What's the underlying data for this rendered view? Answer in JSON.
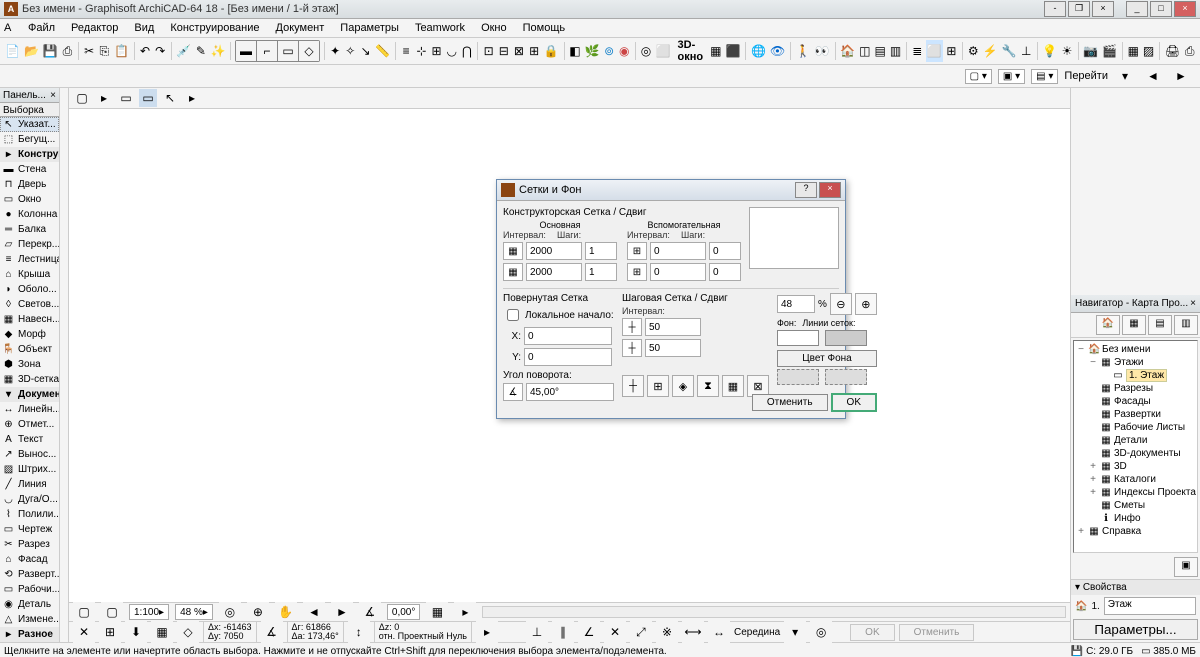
{
  "title": "Без имени - Graphisoft ArchiCAD-64 18 - [Без имени / 1-й этаж]",
  "menu": [
    "Файл",
    "Редактор",
    "Вид",
    "Конструирование",
    "Документ",
    "Параметры",
    "Teamwork",
    "Окно",
    "Помощь"
  ],
  "nav_go": "Перейти",
  "txt3d": "3D-окно",
  "palette": {
    "title": "Панель...",
    "sub": "Выборка"
  },
  "tools": [
    {
      "l": "Указат...",
      "sel": true,
      "ico": "↖"
    },
    {
      "l": "Бегущ...",
      "ico": "⬚"
    },
    {
      "l": "Конструирс",
      "hdr": true,
      "ico": "▸"
    },
    {
      "l": "Стена",
      "ico": "▬"
    },
    {
      "l": "Дверь",
      "ico": "⊓"
    },
    {
      "l": "Окно",
      "ico": "▭"
    },
    {
      "l": "Колонна",
      "ico": "●"
    },
    {
      "l": "Балка",
      "ico": "═"
    },
    {
      "l": "Перекр...",
      "ico": "▱"
    },
    {
      "l": "Лестница",
      "ico": "≡"
    },
    {
      "l": "Крыша",
      "ico": "⌂"
    },
    {
      "l": "Оболо...",
      "ico": "◗"
    },
    {
      "l": "Светов...",
      "ico": "◊"
    },
    {
      "l": "Навесн...",
      "ico": "▦"
    },
    {
      "l": "Морф",
      "ico": "◆"
    },
    {
      "l": "Объект",
      "ico": "🪑"
    },
    {
      "l": "Зона",
      "ico": "⬢"
    },
    {
      "l": "3D-сетка",
      "ico": "▦"
    },
    {
      "l": "Документир",
      "hdr": true,
      "ico": "▾"
    },
    {
      "l": "Линейн...",
      "ico": "↔"
    },
    {
      "l": "Отмет...",
      "ico": "⊕"
    },
    {
      "l": "Текст",
      "ico": "A"
    },
    {
      "l": "Вынос...",
      "ico": "↗"
    },
    {
      "l": "Штрих...",
      "ico": "▨"
    },
    {
      "l": "Линия",
      "ico": "╱"
    },
    {
      "l": "Дуга/О...",
      "ico": "◡"
    },
    {
      "l": "Полили...",
      "ico": "⌇"
    },
    {
      "l": "Чертеж",
      "ico": "▭"
    },
    {
      "l": "Разрез",
      "ico": "✂"
    },
    {
      "l": "Фасад",
      "ico": "⌂"
    },
    {
      "l": "Разверт...",
      "ico": "⟲"
    },
    {
      "l": "Рабочи...",
      "ico": "▭"
    },
    {
      "l": "Деталь",
      "ico": "◉"
    },
    {
      "l": "Измене...",
      "ico": "△"
    },
    {
      "l": "Разное",
      "hdr": true,
      "ico": "▸"
    }
  ],
  "navigator": {
    "title": "Навигатор - Карта Про...",
    "tree": [
      {
        "l": "Без имени",
        "ico": "🏠",
        "exp": "−",
        "ind": 0
      },
      {
        "l": "Этажи",
        "ico": "▦",
        "exp": "−",
        "ind": 1
      },
      {
        "l": "1. Этаж",
        "ico": "▭",
        "ind": 2,
        "sel": true
      },
      {
        "l": "Разрезы",
        "ico": "▦",
        "ind": 1
      },
      {
        "l": "Фасады",
        "ico": "▦",
        "ind": 1
      },
      {
        "l": "Развертки",
        "ico": "▦",
        "ind": 1
      },
      {
        "l": "Рабочие Листы",
        "ico": "▦",
        "ind": 1
      },
      {
        "l": "Детали",
        "ico": "▦",
        "ind": 1
      },
      {
        "l": "3D-документы",
        "ico": "▦",
        "ind": 1
      },
      {
        "l": "3D",
        "ico": "▦",
        "exp": "+",
        "ind": 1
      },
      {
        "l": "Каталоги",
        "ico": "▦",
        "exp": "+",
        "ind": 1
      },
      {
        "l": "Индексы Проекта",
        "ico": "▦",
        "exp": "+",
        "ind": 1
      },
      {
        "l": "Сметы",
        "ico": "▦",
        "ind": 1
      },
      {
        "l": "Инфо",
        "ico": "ℹ",
        "ind": 1
      },
      {
        "l": "Справка",
        "ico": "▦",
        "exp": "+",
        "ind": 0
      }
    ],
    "props": {
      "title": "Свойства",
      "n": "1.",
      "name": "Этаж",
      "btn": "Параметры..."
    }
  },
  "dialog": {
    "title": "Сетки и Фон",
    "s1": "Конструкторская Сетка / Сдвиг",
    "main": "Основная",
    "aux": "Вспомогательная",
    "interval": "Интервал:",
    "steps": "Шаги:",
    "v1": "2000",
    "v2": "1",
    "v3": "2000",
    "v4": "1",
    "v5": "0",
    "v6": "0",
    "v7": "0",
    "v8": "0",
    "s2": "Повернутая Сетка",
    "local": "Локальное начало:",
    "x": "X:",
    "y": "Y:",
    "xv": "0",
    "yv": "0",
    "angle": "Угол поворота:",
    "anglev": "45,00°",
    "s3": "Шаговая Сетка / Сдвиг",
    "sv1": "50",
    "sv2": "50",
    "pct": "48",
    "pctl": "%",
    "bg": "Фон:",
    "lines": "Линии сеток:",
    "bgbtn": "Цвет Фона",
    "cancel": "Отменить",
    "ok": "OK"
  },
  "coords": {
    "dx": "Δx: -61463",
    "dy": "Δy: 7050",
    "dr": "Δг: 61866",
    "da": "Δа: 173,46°",
    "dz": "Δz: 0",
    "ref": "отн. Проектный Нуль",
    "mid": "Середина",
    "ok": "OK",
    "cancel": "Отменить"
  },
  "bottom": {
    "scale": "1:100",
    "zoom": "48 %",
    "ang": "0,00°"
  },
  "status": {
    "hint": "Щелкните на элементе или начертите область выбора. Нажмите и не отпускайте Ctrl+Shift для переключения выбора элемента/подэлемента.",
    "c": "C: 29.0 ГБ",
    "m": "385.0 МБ"
  }
}
